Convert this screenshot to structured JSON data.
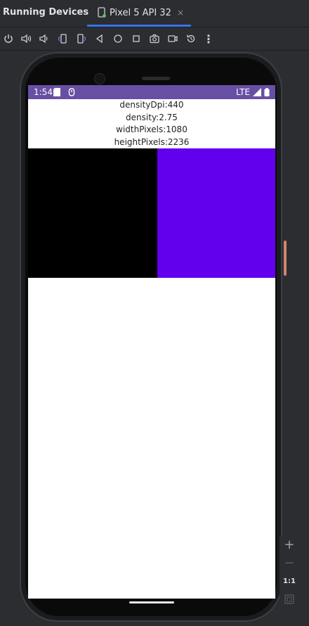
{
  "panel": {
    "title": "Running Devices"
  },
  "tab": {
    "label": "Pixel 5 API 32",
    "close": "×"
  },
  "toolbar": {
    "icons": [
      "power-icon",
      "volume-up-icon",
      "volume-down-icon",
      "rotate-left-icon",
      "rotate-right-icon",
      "back-icon",
      "home-icon",
      "overview-icon",
      "screenshot-icon",
      "screen-record-icon",
      "reset-icon",
      "more-icon"
    ],
    "more_glyph": "⋮"
  },
  "device": {
    "status_bar": {
      "time": "1:54",
      "network": "LTE",
      "color": "#6750a4"
    },
    "info": {
      "density_dpi": "densityDpi:440",
      "density": "density:2.75",
      "width_pixels": "widthPixels:1080",
      "height_pixels": "heightPixels:2236"
    },
    "boxes": {
      "left_color": "#000000",
      "right_color": "#6200ee"
    }
  },
  "zoom": {
    "zoom_in": "+",
    "zoom_out": "−",
    "actual_size": "1:1"
  }
}
